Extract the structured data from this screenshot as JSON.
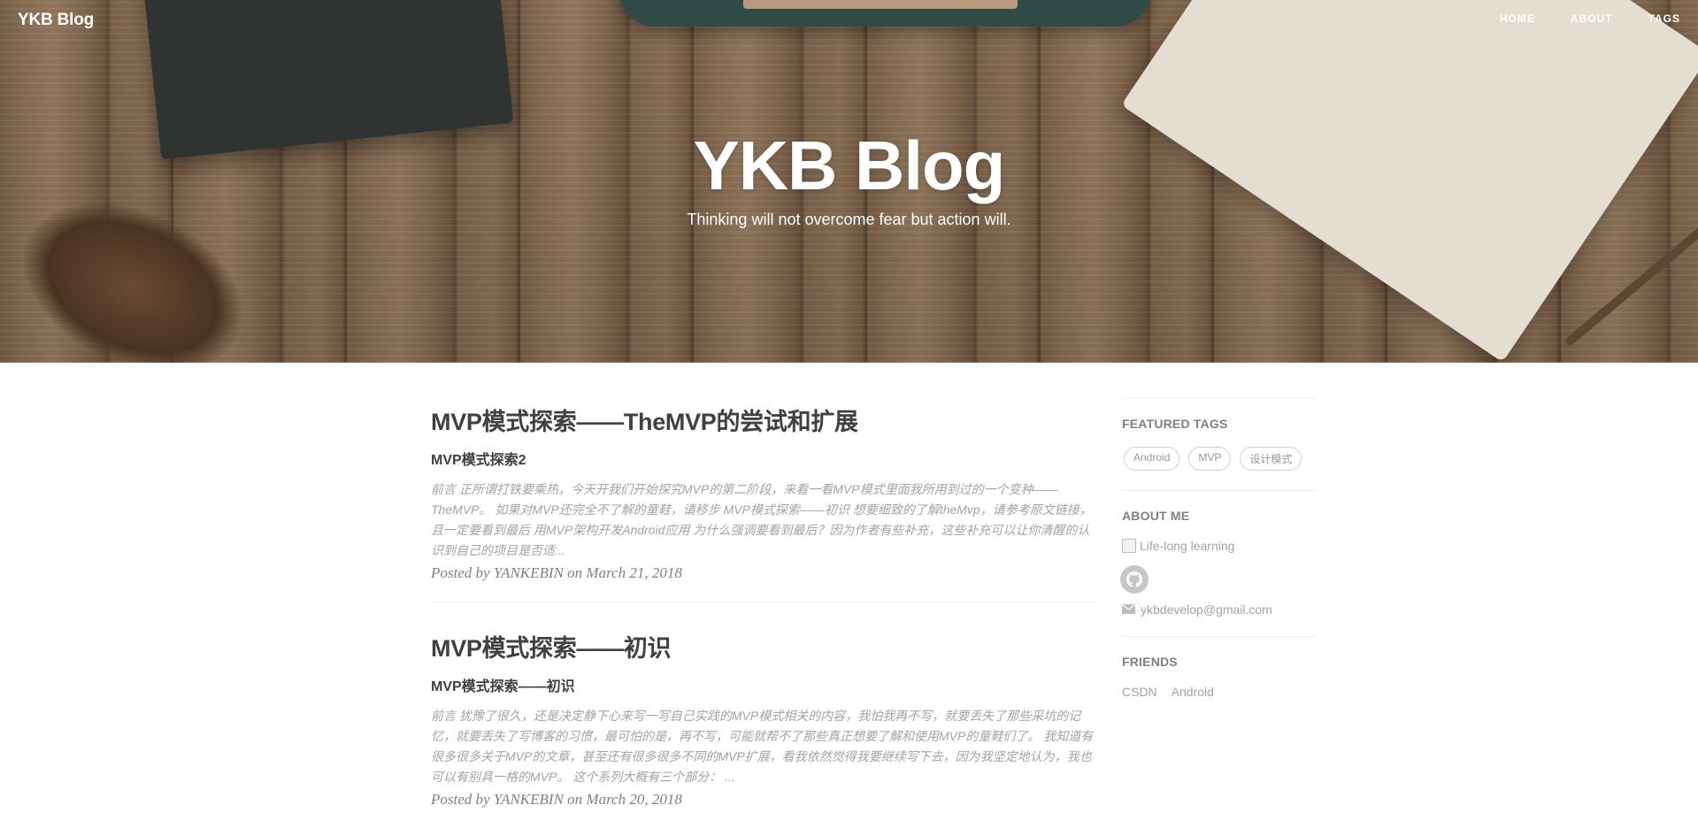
{
  "brand": "YKB Blog",
  "nav": [
    {
      "label": "HOME"
    },
    {
      "label": "ABOUT"
    },
    {
      "label": "TAGS"
    }
  ],
  "hero": {
    "title": "YKB Blog",
    "subtitle": "Thinking will not overcome fear but action will."
  },
  "posts": [
    {
      "title": "MVP模式探索——TheMVP的尝试和扩展",
      "subtitle": "MVP模式探索2",
      "excerpt": "前言 正所谓打铁要乘热，今天开我们开始探究MVP的第二阶段，来看一看MVP模式里面我所用到过的一个变种——TheMVP。 如果对MVP还完全不了解的童鞋，请移步 MVP模式探索——初识 想要细致的了解theMvp，请参考原文链接，且一定要看到最后 用MVP架构开发Android应用 为什么强调要看到最后？因为作者有些补充，这些补充可以让你清醒的认识到自己的项目是否适...",
      "meta": "Posted by YANKEBIN on March 21, 2018"
    },
    {
      "title": "MVP模式探索——初识",
      "subtitle": "MVP模式探索——初识",
      "excerpt": "前言 犹豫了很久，还是决定静下心来写一写自己实践的MVP模式相关的内容，我怕我再不写，就要丢失了那些采坑的记忆，就要丢失了写博客的习惯，最可怕的是，再不写，可能就帮不了那些真正想要了解和使用MVP的童鞋们了。 我知道有很多很多关于MVP的文章，甚至还有很多很多不同的MVP扩展，看我依然觉得我要继续写下去，因为我坚定地认为，我也可以有别具一格的MVP。 这个系列大概有三个部分： ...",
      "meta": "Posted by YANKEBIN on March 20, 2018"
    }
  ],
  "sidebar": {
    "featured_title": "FEATURED TAGS",
    "tags": [
      "Android",
      "MVP",
      "设计模式"
    ],
    "about_title": "ABOUT ME",
    "about_img_alt": "Life-long learning",
    "email": "ykbdevelop@gmail.com",
    "friends_title": "FRIENDS",
    "friends": [
      "CSDN",
      "Android"
    ]
  },
  "colors": {
    "text": "#404040",
    "muted": "#a3a3a3",
    "meta": "#808080",
    "border": "#eeeeee"
  }
}
